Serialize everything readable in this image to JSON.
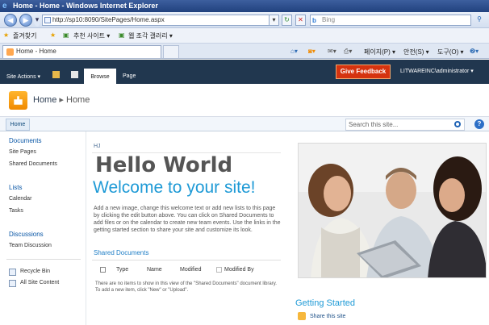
{
  "browser": {
    "title": "Home - Home - Windows Internet Explorer",
    "address": "http://sp10:8090/SitePages/Home.aspx",
    "search_placeholder": "Bing",
    "search_brand": "b",
    "favorites_label": "즐겨찾기",
    "suggested_sites": "추천 사이트 ▾",
    "web_slice_gallery": "웹 조각 갤러리 ▾",
    "tab_title": "Home - Home",
    "tools": {
      "page": "페이지(P) ▾",
      "safety": "안전(S) ▾",
      "tools": "도구(O) ▾",
      "help": "❷▾"
    }
  },
  "ribbon": {
    "site_actions": "Site Actions ▾",
    "browse": "Browse",
    "page": "Page",
    "feedback": "Give Feedback",
    "user": "LITWAREINC\\administrator ▾"
  },
  "site": {
    "breadcrumb_site": "Home",
    "breadcrumb_sep": "▸",
    "breadcrumb_page": "Home",
    "top_nav_home": "Home",
    "search_placeholder": "Search this site...",
    "help": "?"
  },
  "quick_launch": {
    "documents": "Documents",
    "site_pages": "Site Pages",
    "shared_documents": "Shared Documents",
    "lists": "Lists",
    "calendar": "Calendar",
    "tasks": "Tasks",
    "discussions": "Discussions",
    "team_discussion": "Team Discussion",
    "recycle_bin": "Recycle Bin",
    "all_site_content": "All Site Content"
  },
  "main": {
    "hj": "HJ",
    "hello": "Hello World",
    "welcome": "Welcome to your site!",
    "description": "Add a new image, change this welcome text or add new lists to this page by clicking the edit button above. You can click on Shared Documents to add files or on the calendar to create new team events. Use the links in the getting started section to share your site and customize its look.",
    "shared_docs_title": "Shared Documents",
    "columns": [
      "Type",
      "Name",
      "Modified",
      "Modified By"
    ],
    "empty_text": "There are no items to show in this view of the \"Shared Documents\" document library. To add a new item, click \"New\" or \"Upload\".",
    "getting_started": "Getting Started",
    "share_site": "Share this site"
  }
}
